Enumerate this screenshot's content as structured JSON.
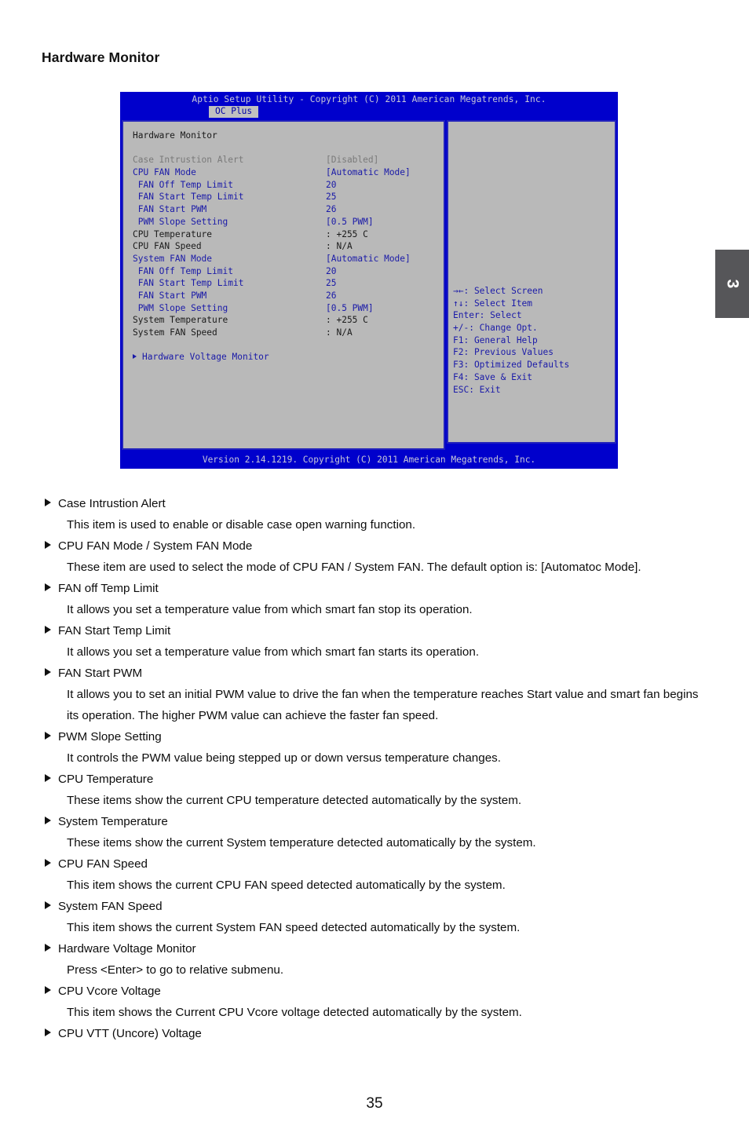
{
  "page": {
    "title": "Hardware Monitor",
    "number": "35",
    "chapter_tab": "3"
  },
  "bios": {
    "titlebar": "Aptio Setup Utility - Copyright (C) 2011 American Megatrends, Inc.",
    "active_tab": "OC Plus",
    "section_heading": "Hardware Monitor",
    "footer": "Version 2.14.1219. Copyright (C) 2011 American Megatrends, Inc.",
    "colors": {
      "header_blue": "#0000cc",
      "pane_grey": "#b9b9b9",
      "border_blue": "#2222bb",
      "text_blue": "#1a1aa8",
      "text_grey": "#7a7a7a",
      "text_dark": "#1a1a1a"
    },
    "rows": [
      {
        "label": "Case Intrustion Alert",
        "value": "[Disabled]",
        "style": "grey",
        "indent": 0
      },
      {
        "label": "CPU FAN Mode",
        "value": "[Automatic Mode]",
        "style": "blue",
        "indent": 0
      },
      {
        "label": "FAN Off Temp Limit",
        "value": "20",
        "style": "blue",
        "indent": 1
      },
      {
        "label": "FAN Start Temp Limit",
        "value": "25",
        "style": "blue",
        "indent": 1
      },
      {
        "label": "FAN Start PWM",
        "value": "26",
        "style": "blue",
        "indent": 1
      },
      {
        "label": "PWM Slope Setting",
        "value": "[0.5 PWM]",
        "style": "blue",
        "indent": 1
      },
      {
        "label": "CPU Temperature",
        "value": ": +255 C",
        "style": "dark",
        "indent": 0
      },
      {
        "label": "CPU FAN Speed",
        "value": ": N/A",
        "style": "dark",
        "indent": 0
      },
      {
        "label": "System FAN Mode",
        "value": "[Automatic Mode]",
        "style": "blue",
        "indent": 0
      },
      {
        "label": "FAN Off Temp Limit",
        "value": "20",
        "style": "blue",
        "indent": 1
      },
      {
        "label": "FAN Start Temp Limit",
        "value": "25",
        "style": "blue",
        "indent": 1
      },
      {
        "label": "FAN Start PWM",
        "value": "26",
        "style": "blue",
        "indent": 1
      },
      {
        "label": "PWM Slope Setting",
        "value": "[0.5 PWM]",
        "style": "blue",
        "indent": 1
      },
      {
        "label": "System Temperature",
        "value": ": +255 C",
        "style": "dark",
        "indent": 0
      },
      {
        "label": "System FAN Speed",
        "value": ": N/A",
        "style": "dark",
        "indent": 0
      }
    ],
    "submenu_label": "Hardware Voltage Monitor",
    "help_keys": [
      "→←: Select Screen",
      "↑↓: Select Item",
      "Enter: Select",
      "+/-: Change Opt.",
      "F1: General Help",
      "F2: Previous Values",
      "F3: Optimized Defaults",
      "F4: Save & Exit",
      "ESC: Exit"
    ]
  },
  "descriptions": [
    {
      "term": "Case Intrustion Alert",
      "body": "This item is used to enable or disable case open warning function."
    },
    {
      "term": "CPU FAN Mode / System FAN Mode",
      "body": "These item are used to select the mode of CPU FAN / System FAN. The default option is: [Automatoc Mode]."
    },
    {
      "term": "FAN off Temp Limit",
      "body": "It allows you set a temperature value from which smart fan stop its operation."
    },
    {
      "term": "FAN Start Temp Limit",
      "body": "It allows you set a temperature value from which smart fan starts its operation."
    },
    {
      "term": "FAN Start PWM",
      "body": "It allows you to set an initial PWM value to drive the fan when the temperature reaches Start value and smart fan begins its operation. The higher PWM value can achieve the faster fan speed."
    },
    {
      "term": "PWM Slope Setting",
      "body": "It controls the PWM value being stepped up or down versus temperature changes."
    },
    {
      "term": "CPU Temperature",
      "body": "These items show the current CPU temperature detected automatically by the system."
    },
    {
      "term": "System Temperature",
      "body": "These items show the current System temperature detected automatically by the system."
    },
    {
      "term": "CPU FAN Speed",
      "body": "This item shows the current CPU FAN speed detected automatically by the system."
    },
    {
      "term": "System FAN Speed",
      "body": "This item shows the current System FAN speed detected automatically by the system."
    },
    {
      "term": "Hardware Voltage Monitor",
      "body": " Press <Enter> to go to relative submenu."
    },
    {
      "term": "CPU Vcore Voltage",
      "body": "This item shows the Current CPU Vcore voltage detected automatically by the system."
    },
    {
      "term": "CPU VTT (Uncore) Voltage",
      "body": ""
    }
  ]
}
